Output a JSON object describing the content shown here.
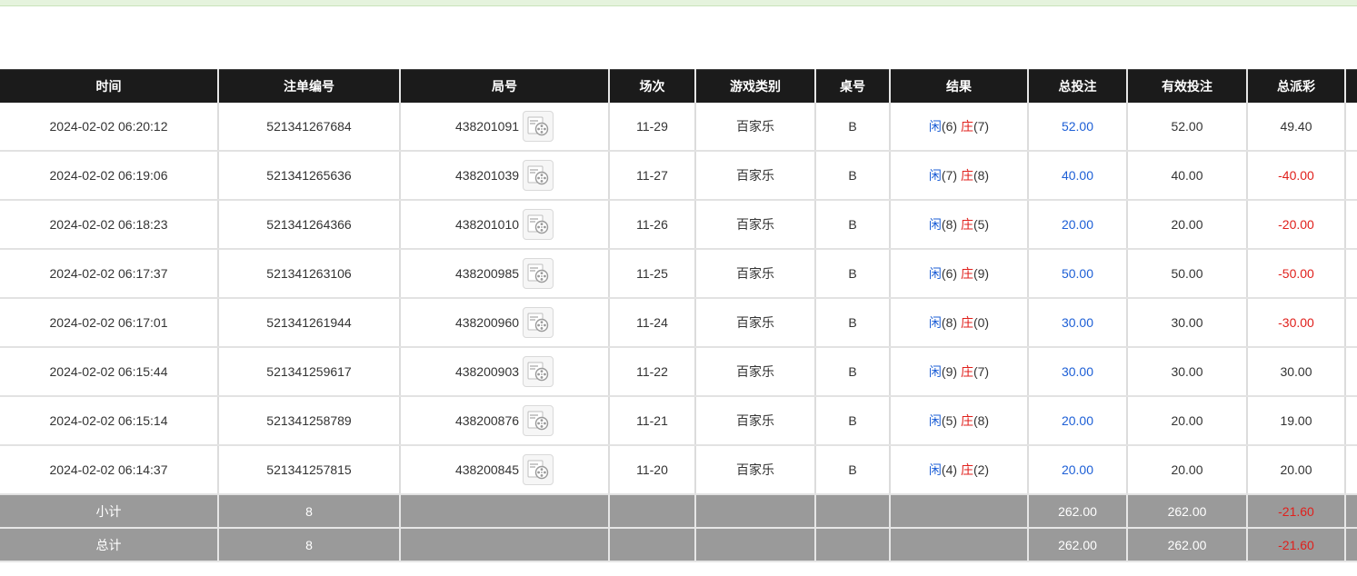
{
  "table": {
    "headers": [
      "时间",
      "注单编号",
      "局号",
      "场次",
      "游戏类别",
      "桌号",
      "结果",
      "总投注",
      "有效投注",
      "总派彩"
    ],
    "rows": [
      {
        "time": "2024-02-02 06:20:12",
        "bet_id": "521341267684",
        "round_id": "438201091",
        "session": "11-29",
        "game": "百家乐",
        "table": "B",
        "player_label": "闲",
        "player_score": "(6)",
        "banker_label": "庄",
        "banker_score": "(7)",
        "total_bet": "52.00",
        "valid_bet": "52.00",
        "payout": "49.40",
        "payout_negative": false
      },
      {
        "time": "2024-02-02 06:19:06",
        "bet_id": "521341265636",
        "round_id": "438201039",
        "session": "11-27",
        "game": "百家乐",
        "table": "B",
        "player_label": "闲",
        "player_score": "(7)",
        "banker_label": "庄",
        "banker_score": "(8)",
        "total_bet": "40.00",
        "valid_bet": "40.00",
        "payout": "-40.00",
        "payout_negative": true
      },
      {
        "time": "2024-02-02 06:18:23",
        "bet_id": "521341264366",
        "round_id": "438201010",
        "session": "11-26",
        "game": "百家乐",
        "table": "B",
        "player_label": "闲",
        "player_score": "(8)",
        "banker_label": "庄",
        "banker_score": "(5)",
        "total_bet": "20.00",
        "valid_bet": "20.00",
        "payout": "-20.00",
        "payout_negative": true
      },
      {
        "time": "2024-02-02 06:17:37",
        "bet_id": "521341263106",
        "round_id": "438200985",
        "session": "11-25",
        "game": "百家乐",
        "table": "B",
        "player_label": "闲",
        "player_score": "(6)",
        "banker_label": "庄",
        "banker_score": "(9)",
        "total_bet": "50.00",
        "valid_bet": "50.00",
        "payout": "-50.00",
        "payout_negative": true
      },
      {
        "time": "2024-02-02 06:17:01",
        "bet_id": "521341261944",
        "round_id": "438200960",
        "session": "11-24",
        "game": "百家乐",
        "table": "B",
        "player_label": "闲",
        "player_score": "(8)",
        "banker_label": "庄",
        "banker_score": "(0)",
        "total_bet": "30.00",
        "valid_bet": "30.00",
        "payout": "-30.00",
        "payout_negative": true
      },
      {
        "time": "2024-02-02 06:15:44",
        "bet_id": "521341259617",
        "round_id": "438200903",
        "session": "11-22",
        "game": "百家乐",
        "table": "B",
        "player_label": "闲",
        "player_score": "(9)",
        "banker_label": "庄",
        "banker_score": "(7)",
        "total_bet": "30.00",
        "valid_bet": "30.00",
        "payout": "30.00",
        "payout_negative": false
      },
      {
        "time": "2024-02-02 06:15:14",
        "bet_id": "521341258789",
        "round_id": "438200876",
        "session": "11-21",
        "game": "百家乐",
        "table": "B",
        "player_label": "闲",
        "player_score": "(5)",
        "banker_label": "庄",
        "banker_score": "(8)",
        "total_bet": "20.00",
        "valid_bet": "20.00",
        "payout": "19.00",
        "payout_negative": false
      },
      {
        "time": "2024-02-02 06:14:37",
        "bet_id": "521341257815",
        "round_id": "438200845",
        "session": "11-20",
        "game": "百家乐",
        "table": "B",
        "player_label": "闲",
        "player_score": "(4)",
        "banker_label": "庄",
        "banker_score": "(2)",
        "total_bet": "20.00",
        "valid_bet": "20.00",
        "payout": "20.00",
        "payout_negative": false
      }
    ],
    "subtotal": {
      "label": "小计",
      "count": "8",
      "total_bet": "262.00",
      "valid_bet": "262.00",
      "payout": "-21.60"
    },
    "grand_total": {
      "label": "总计",
      "count": "8",
      "total_bet": "262.00",
      "valid_bet": "262.00",
      "payout": "-21.60"
    }
  },
  "icons": {
    "replay": "video-replay-icon"
  },
  "colors": {
    "header_bg": "#1b1b1b",
    "footer_bg": "#9a9a9a",
    "bet_blue": "#1d5fd6",
    "negative_red": "#e0201c",
    "top_strip": "#e5f3dd"
  }
}
